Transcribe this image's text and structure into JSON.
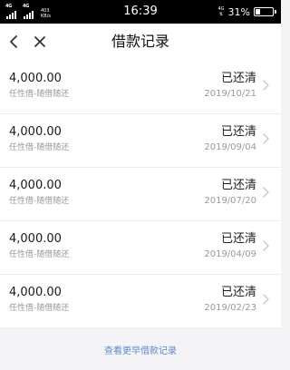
{
  "status_bar": {
    "sim1": "4G",
    "sim2": "4G",
    "speed_value": "403",
    "speed_unit": "KB/s",
    "time": "16:39",
    "network_indicator": "4G",
    "battery_percent": 31,
    "battery_label": "31%"
  },
  "header": {
    "title": "借款记录",
    "back_icon": "chevron-left-icon",
    "close_icon": "close-icon"
  },
  "records": [
    {
      "amount": "4,000.00",
      "type": "任性借-随借随还",
      "status": "已还清",
      "date": "2019/10/21"
    },
    {
      "amount": "4,000.00",
      "type": "任性借-随借随还",
      "status": "已还清",
      "date": "2019/09/04"
    },
    {
      "amount": "4,000.00",
      "type": "任性借-随借随还",
      "status": "已还清",
      "date": "2019/07/20"
    },
    {
      "amount": "4,000.00",
      "type": "任性借-随借随还",
      "status": "已还清",
      "date": "2019/04/09"
    },
    {
      "amount": "4,000.00",
      "type": "任性借-随借随还",
      "status": "已还清",
      "date": "2019/02/23"
    }
  ],
  "footer": {
    "more_label": "查看更早借款记录"
  },
  "colors": {
    "link": "#5b8bd0",
    "muted_text": "#999999",
    "page_background": "#f4f4f6"
  }
}
